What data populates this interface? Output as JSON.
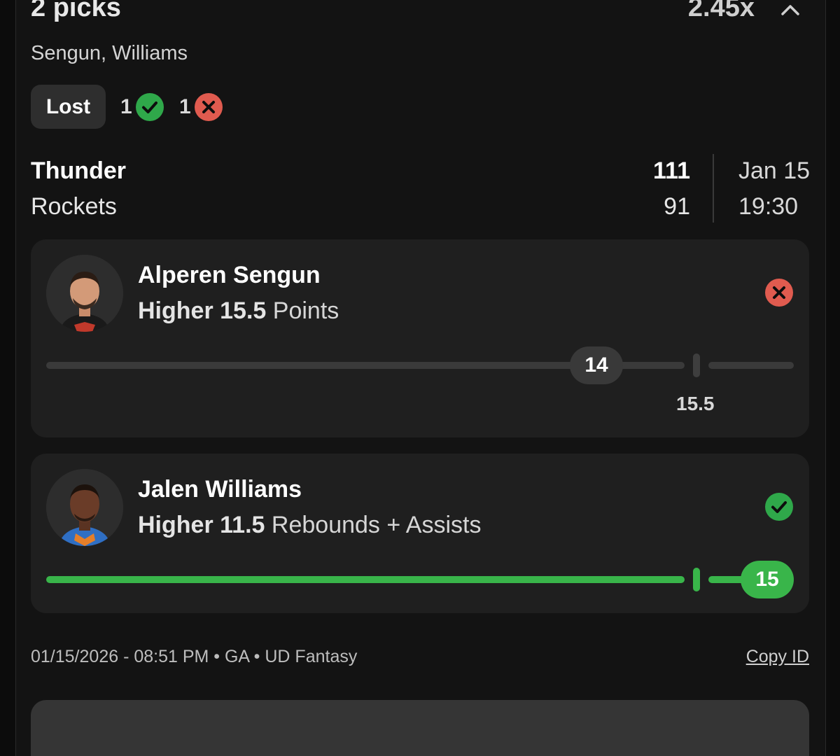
{
  "header": {
    "title": "2 picks",
    "multiplier": "2.45x",
    "chevron_icon": "chevron-up-icon",
    "players_summary": "Sengun, Williams"
  },
  "status": {
    "label": "Lost",
    "wins_count": "1",
    "losses_count": "1",
    "win_icon": "check-circle-icon",
    "loss_icon": "x-circle-icon"
  },
  "game": {
    "team_home": "Thunder",
    "team_away": "Rockets",
    "score_home": "111",
    "score_away": "91",
    "date": "Jan 15",
    "time": "19:30"
  },
  "picks": [
    {
      "player": "Alperen Sengun",
      "direction": "Higher",
      "line": "15.5",
      "stat": "Points",
      "actual": "14",
      "line_label": "15.5",
      "result": "loss",
      "progress_fraction": 0.74,
      "result_icon": "x-circle-icon"
    },
    {
      "player": "Jalen Williams",
      "direction": "Higher",
      "line": "11.5",
      "stat": "Rebounds + Assists",
      "actual": "15",
      "result": "win",
      "progress_fraction": 1.0,
      "result_icon": "check-circle-icon"
    }
  ],
  "footer": {
    "meta": "01/15/2026 - 08:51 PM • GA • UD Fantasy",
    "copy_id": "Copy ID"
  },
  "colors": {
    "win": "#39b54a",
    "loss": "#e05b4f",
    "card": "#1f1f1f",
    "background": "#131313"
  }
}
